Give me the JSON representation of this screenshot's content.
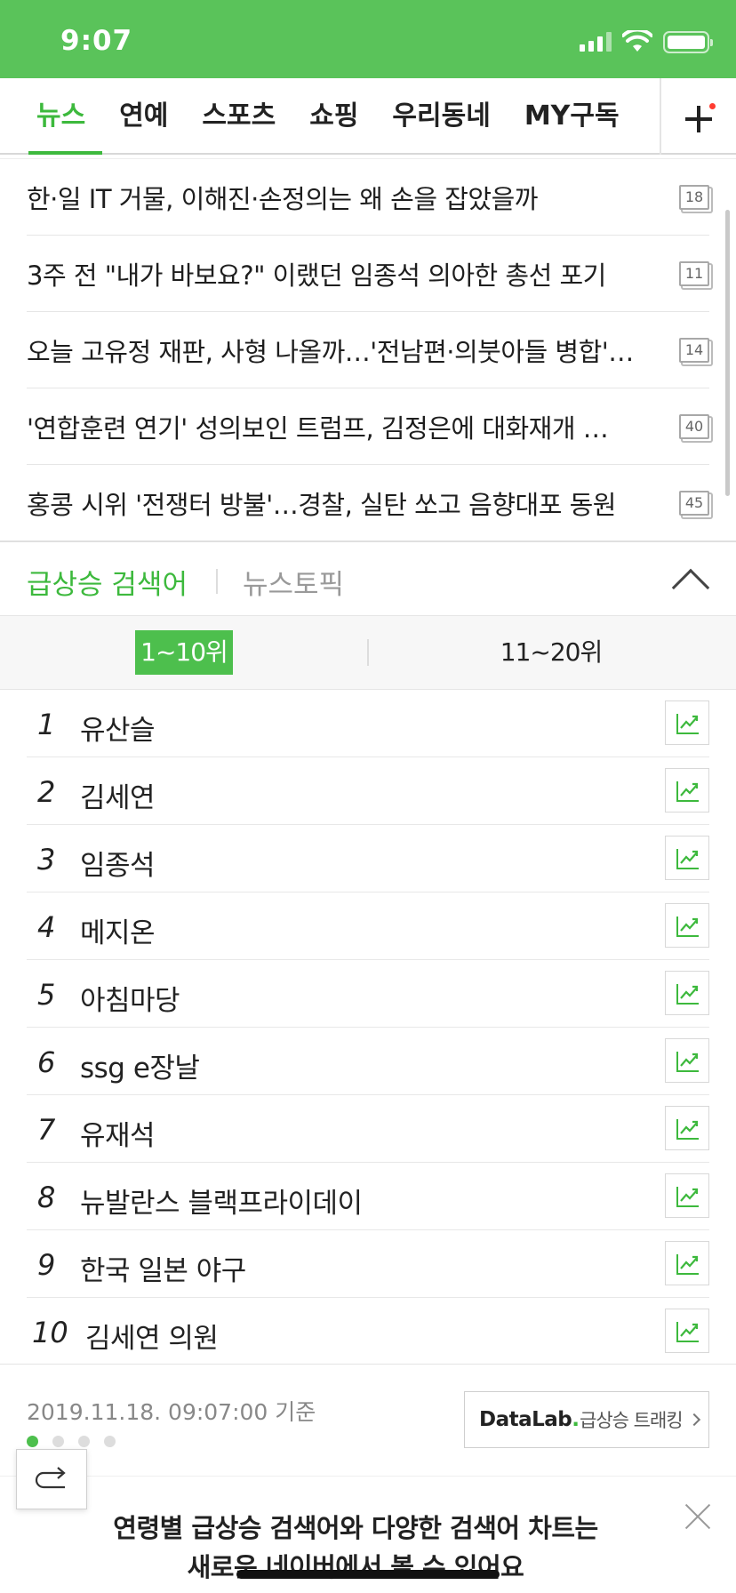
{
  "status": {
    "time": "9:07"
  },
  "tabs": [
    "뉴스",
    "연예",
    "스포츠",
    "쇼핑",
    "우리동네",
    "MY구독"
  ],
  "news": [
    {
      "title": "한·일 IT 거물, 이해진·손정의는 왜 손을 잡았을까",
      "comments": "18"
    },
    {
      "title": "3주 전 \"내가 바보요?\" 이랬던 임종석 의아한 총선 포기",
      "comments": "11"
    },
    {
      "title": "오늘 고유정 재판, 사형 나올까…'전남편·의붓아들 병합'…",
      "comments": "14"
    },
    {
      "title": "'연합훈련 연기' 성의보인 트럼프, 김정은에 대화재개 …",
      "comments": "40"
    },
    {
      "title": "홍콩 시위 '전쟁터 방불'…경찰, 실탄 쏘고 음향대포 동원",
      "comments": "45"
    }
  ],
  "trend": {
    "title": "급상승 검색어",
    "topic_tab": "뉴스토픽",
    "seg_active": "1~10위",
    "seg_other": "11~20위",
    "ranks": [
      {
        "num": "1",
        "keyword": "유산슬"
      },
      {
        "num": "2",
        "keyword": "김세연"
      },
      {
        "num": "3",
        "keyword": "임종석"
      },
      {
        "num": "4",
        "keyword": "메지온"
      },
      {
        "num": "5",
        "keyword": "아침마당"
      },
      {
        "num": "6",
        "keyword": "ssg e장날"
      },
      {
        "num": "7",
        "keyword": "유재석"
      },
      {
        "num": "8",
        "keyword": "뉴발란스 블랙프라이데이"
      },
      {
        "num": "9",
        "keyword": "한국 일본 야구"
      },
      {
        "num": "10",
        "keyword": "김세연 의원"
      }
    ],
    "timestamp": "2019.11.18. 09:07:00 기준",
    "datalab_brand": "DataLab",
    "datalab_dot": ".",
    "datalab_text": "급상승 트래킹"
  },
  "banner": {
    "line1": "연령별 급상승 검색어와 다양한 검색어 차트는",
    "line2": "새로운 네이버에서 볼 수 있어요"
  },
  "colors": {
    "brand_green": "#5ac35a",
    "accent_green": "#3db93d"
  }
}
